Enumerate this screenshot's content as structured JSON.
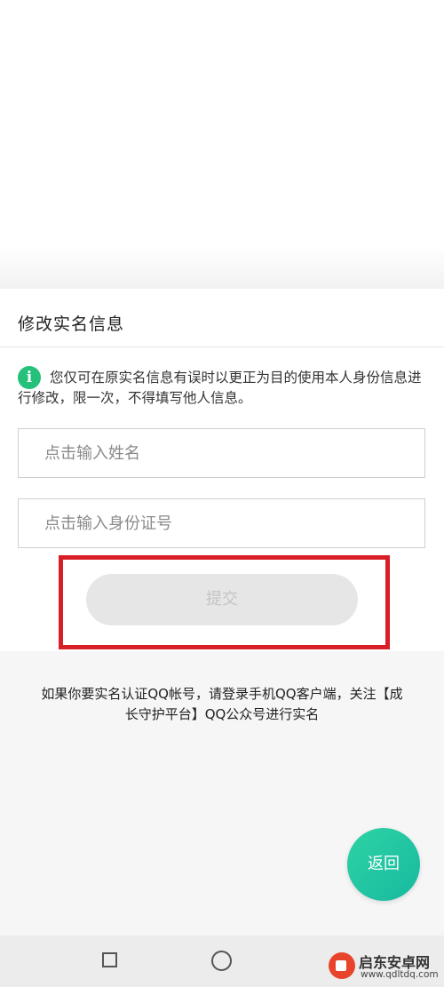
{
  "header": {
    "title": "修改实名信息"
  },
  "notice": {
    "icon": "info-icon",
    "glyph": "i",
    "text": "您仅可在原实名信息有误时以更正为目的使用本人身份信息进行修改，限一次，不得填写他人信息。"
  },
  "form": {
    "name_placeholder": "点击输入姓名",
    "id_placeholder": "点击输入身份证号",
    "submit_label": "提交"
  },
  "footer": {
    "note": "如果你要实名认证QQ帐号，请登录手机QQ客户端，关注【成长守护平台】QQ公众号进行实名"
  },
  "back_button": {
    "label": "返回"
  },
  "nav": {
    "recents": "square-icon",
    "home": "circle-icon"
  },
  "watermark": {
    "name": "启东安卓网",
    "url": "www.qdltdq.com"
  },
  "colors": {
    "accent": "#25c07a",
    "highlight": "#d81f26",
    "back_button": "#1fc3a3",
    "disabled_button": "#e6e6e6"
  }
}
